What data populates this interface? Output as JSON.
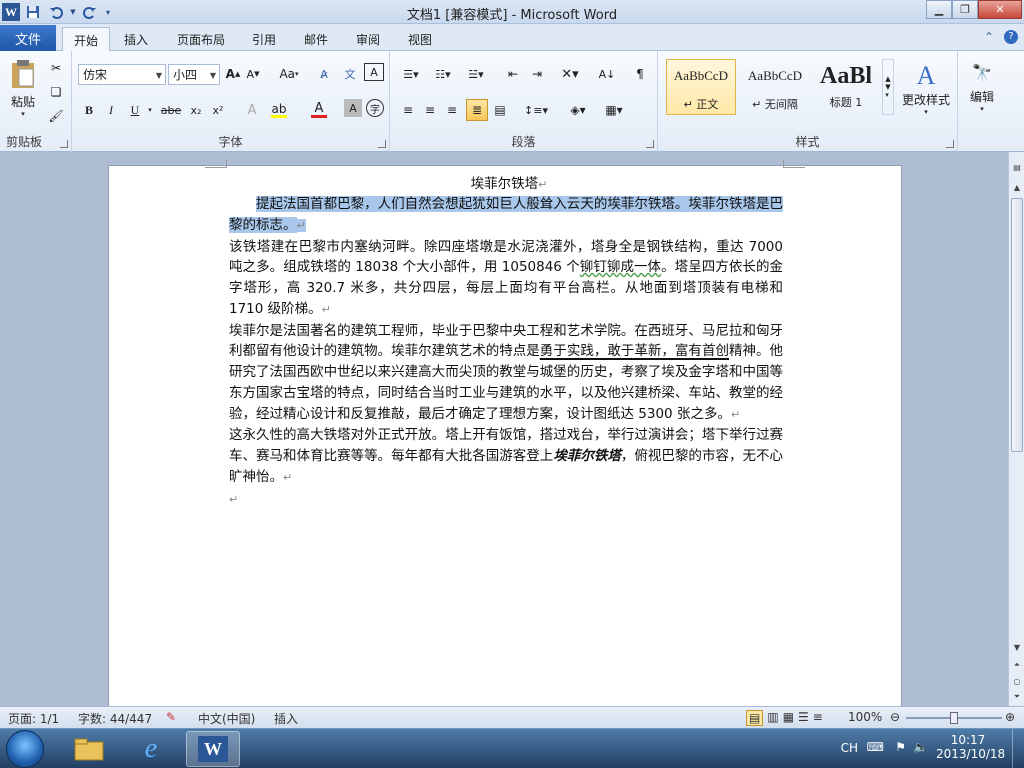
{
  "window": {
    "title": "文档1 [兼容模式]  -  Microsoft Word",
    "app_icon": "W"
  },
  "qat": {
    "save_icon": "save-icon",
    "undo_icon": "undo-icon",
    "redo_icon": "redo-icon",
    "customize_icon": "customize-qat-icon"
  },
  "tabs": [
    {
      "label": "文件"
    },
    {
      "label": "开始"
    },
    {
      "label": "插入"
    },
    {
      "label": "页面布局"
    },
    {
      "label": "引用"
    },
    {
      "label": "邮件"
    },
    {
      "label": "审阅"
    },
    {
      "label": "视图"
    }
  ],
  "ribbon": {
    "clipboard": {
      "label": "剪贴板",
      "paste": "粘贴"
    },
    "font": {
      "label": "字体",
      "font_name": "仿宋",
      "font_size": "小四",
      "grow": "A",
      "shrink": "A",
      "case": "Aa",
      "bold": "B",
      "italic": "I",
      "underline": "U",
      "strike": "abe",
      "subscript": "x₂",
      "superscript": "x²",
      "highlight_color": "#ffff00",
      "font_color": "#e02020"
    },
    "paragraph": {
      "label": "段落"
    },
    "styles": {
      "label": "样式",
      "items": [
        {
          "preview": "AaBbCcD",
          "name": "↵ 正文"
        },
        {
          "preview": "AaBbCcD",
          "name": "↵ 无间隔"
        },
        {
          "preview": "AaBl",
          "name": "标题 1"
        }
      ],
      "change": "更改样式"
    },
    "editing": {
      "label": "编辑"
    }
  },
  "document": {
    "title": "埃菲尔铁塔",
    "p1_sel": "提起法国首都巴黎，人们自然会想起犹如巨人般耸入云天的埃菲尔铁塔。埃菲尔铁塔是巴黎的标志。",
    "p2_a": "该铁塔建在巴黎市内塞纳河畔。除四座塔墩是水泥浇灌外，塔身全是钢铁结构，重达 7000 吨之多。组成铁塔的 18038 个大小部件，用 1050846 个",
    "p2_wavy": "铆钉铆成一体",
    "p2_b": "。塔呈四方依长的金字塔形，高 320.7 米多，共分四层，每层上面均有平台高栏。从地面到塔顶装有电梯和 1710 级阶梯。",
    "p3_a": "埃菲尔是法国著名的建筑工程师，毕业于巴黎中央工程和艺术学院。在西班牙、马尼拉和匈牙利都留有他设计的建筑物。埃菲尔建筑艺术的特点是",
    "p3_u": "勇于实践，敢于革新，富有首创",
    "p3_b": "精神。他研究了法国西欧中世纪以来兴建高大而尖顶的教堂与城堡的历史，考察了埃及金字塔和中国等东方国家古宝塔的特点，同时结合当时工业与建筑的水平，以及他兴建桥梁、车站、教堂的经验，经过精心设计和反复推敲，最后才确定了理想方案，设计图纸达 5300 张之多。",
    "p4_a": "这永久性的高大铁塔对外正式开放。塔上开有饭馆，搭过戏台，举行过演讲会；塔下举行过赛车、赛马和体育比赛等等。每年都有大批各国游客登上",
    "p4_bi": "埃菲尔铁塔",
    "p4_b": "，俯视巴黎的市容，无不心旷神怡。",
    "para_mark": "↵"
  },
  "status": {
    "page": "页面: 1/1",
    "words": "字数: 44/447",
    "language": "中文(中国)",
    "mode": "插入",
    "zoom": "100%",
    "zoom_level": 1.0
  },
  "taskbar": {
    "apps": [
      "explorer",
      "internet-explorer",
      "word"
    ],
    "tray_lang": "CH",
    "time": "10:17",
    "date": "2013/10/18"
  }
}
